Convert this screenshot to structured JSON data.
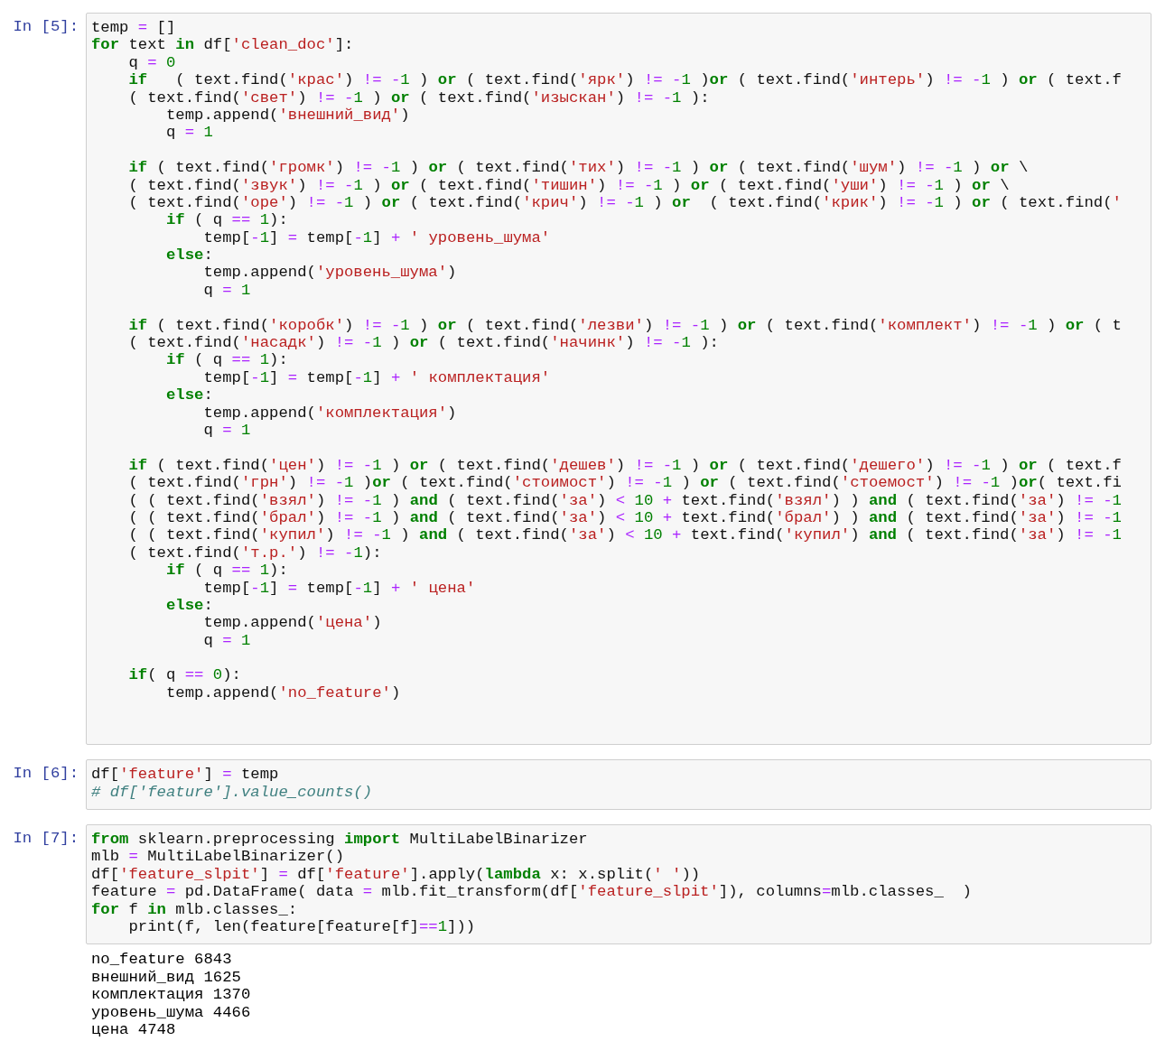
{
  "cells": [
    {
      "prompt": "In [5]:",
      "blocks": [
        [
          "temp = []",
          "**for** text **in** df['clean_doc']:",
          "    q = 0",
          "    **if**   ( text.find('крас') != -1 ) **or** ( text.find('ярк') != -1 )**or** ( text.find('интерь') != -1 ) **or** ( text.f",
          "    ( text.find('свет') != -1 ) **or** ( text.find('изыскан') != -1 ):",
          "        temp.append('внешний_вид')",
          "        q = 1"
        ],
        [
          "    **if** ( text.find('громк') != -1 ) **or** ( text.find('тих') != -1 ) **or** ( text.find('шум') != -1 ) **or** \\",
          "    ( text.find('звук') != -1 ) **or** ( text.find('тишин') != -1 ) **or** ( text.find('уши') != -1 ) **or** \\",
          "    ( text.find('оре') != -1 ) **or** ( text.find('крич') != -1 ) **or**  ( text.find('крик') != -1 ) **or** ( text.find('",
          "        **if** ( q == 1):",
          "            temp[-1] = temp[-1] + ' уровень_шума'",
          "        **else**:",
          "            temp.append('уровень_шума')",
          "            q = 1"
        ],
        [
          "    **if** ( text.find('коробк') != -1 ) **or** ( text.find('лезви') != -1 ) **or** ( text.find('комплект') != -1 ) **or** ( t",
          "    ( text.find('насадк') != -1 ) **or** ( text.find('начинк') != -1 ):",
          "        **if** ( q == 1):",
          "            temp[-1] = temp[-1] + ' комплектация'",
          "        **else**:",
          "            temp.append('комплектация')",
          "            q = 1"
        ],
        [
          "    **if** ( text.find('цен') != -1 ) **or** ( text.find('дешев') != -1 ) **or** ( text.find('дешего') != -1 ) **or** ( text.f",
          "    ( text.find('грн') != -1 )**or** ( text.find('стоимост') != -1 ) **or** ( text.find('стоемост') != -1 )**or**( text.fi",
          "    ( ( text.find('взял') != -1 ) **and** ( text.find('за') < 10 + text.find('взял') ) **and** ( text.find('за') != -1",
          "    ( ( text.find('брал') != -1 ) **and** ( text.find('за') < 10 + text.find('брал') ) **and** ( text.find('за') != -1",
          "    ( ( text.find('купил') != -1 ) **and** ( text.find('за') < 10 + text.find('купил') **and** ( text.find('за') != -1",
          "    ( text.find('т.р.') != -1):",
          "        **if** ( q == 1):",
          "            temp[-1] = temp[-1] + ' цена'",
          "        **else**:",
          "            temp.append('цена')",
          "            q = 1"
        ],
        [
          "    **if**( q == 0):",
          "        temp.append('no_feature')"
        ]
      ]
    },
    {
      "prompt": "In [6]:",
      "blocks": [
        [
          "df['feature'] = temp",
          "# df['feature'].value_counts()"
        ]
      ]
    },
    {
      "prompt": "In [7]:",
      "blocks": [
        [
          "**from** sklearn.preprocessing **import** MultiLabelBinarizer",
          "mlb = MultiLabelBinarizer()",
          "df['feature_slpit'] = df['feature'].apply(**lambda** x: x.split(' '))",
          "feature = pd.DataFrame( data = mlb.fit_transform(df['feature_slpit']), columns=mlb.classes_  )",
          "**for** f **in** mlb.classes_:",
          "    print(f, len(feature[feature[f]==1]))"
        ]
      ],
      "output": [
        "no_feature 6843",
        "внешний_вид 1625",
        "комплектация 1370",
        "уровень_шума 4466",
        "цена 4748"
      ]
    }
  ]
}
